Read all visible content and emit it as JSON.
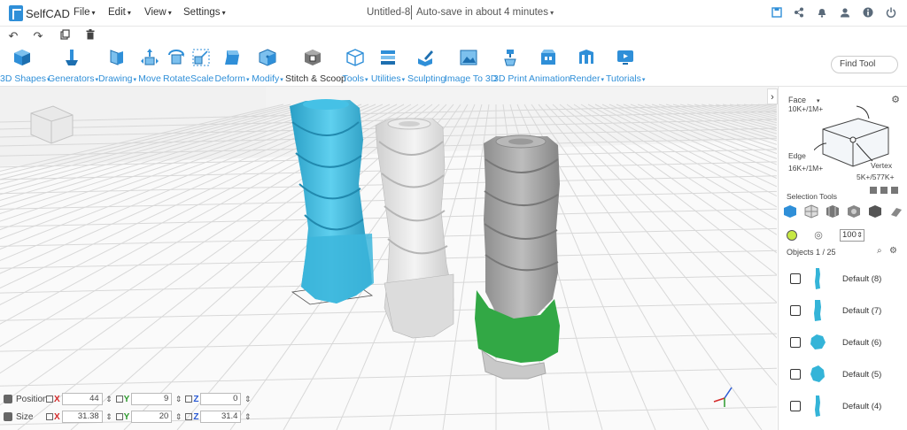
{
  "app": {
    "logo_text": "SelfCAD",
    "doc_title": "Untitled-8",
    "autosave": "Auto-save in about 4 minutes"
  },
  "menus": [
    "File",
    "Edit",
    "View",
    "Settings"
  ],
  "toolbar": {
    "tools": [
      {
        "label": "3D Shapes",
        "drop": true
      },
      {
        "label": "Generators",
        "drop": true
      },
      {
        "label": "Drawing",
        "drop": true
      },
      {
        "label": "Move",
        "drop": false
      },
      {
        "label": "Rotate",
        "drop": false
      },
      {
        "label": "Scale",
        "drop": false
      },
      {
        "label": "Deform",
        "drop": true
      },
      {
        "label": "Modify",
        "drop": true
      },
      {
        "label": "Stitch & Scoop",
        "drop": false
      },
      {
        "label": "Tools",
        "drop": true
      },
      {
        "label": "Utilities",
        "drop": true
      },
      {
        "label": "Sculpting",
        "drop": false
      },
      {
        "label": "Image To 3D",
        "drop": false
      },
      {
        "label": "3D Print",
        "drop": false
      },
      {
        "label": "Animation",
        "drop": false
      },
      {
        "label": "Render",
        "drop": true
      },
      {
        "label": "Tutorials",
        "drop": true
      }
    ],
    "find_tool": "Find Tool"
  },
  "transform": {
    "position": {
      "label": "Position",
      "x": "44",
      "y": "9",
      "z": "0"
    },
    "size": {
      "label": "Size",
      "x": "31.38",
      "y": "20",
      "z": "31.4"
    },
    "axes": {
      "x": "X",
      "y": "Y",
      "z": "Z"
    }
  },
  "sidebar": {
    "face_label": "Face",
    "face_count": "10K+/1M+",
    "edge_label": "Edge",
    "edge_count": "16K+/1M+",
    "vertex_label": "Vertex",
    "vertex_count": "5K+/577K+",
    "selection_tools": "Selection Tools",
    "opacity": "100",
    "objects_header": "Objects 1 / 25",
    "objects": [
      "Default (8)",
      "Default (7)",
      "Default (6)",
      "Default (5)",
      "Default (4)"
    ]
  },
  "colors": {
    "accent": "#2f8fd8",
    "cyan_object": "#34b4d8",
    "white_object": "#e8e8e8",
    "gray_object": "#a6a6a6",
    "green_object": "#32a845"
  }
}
